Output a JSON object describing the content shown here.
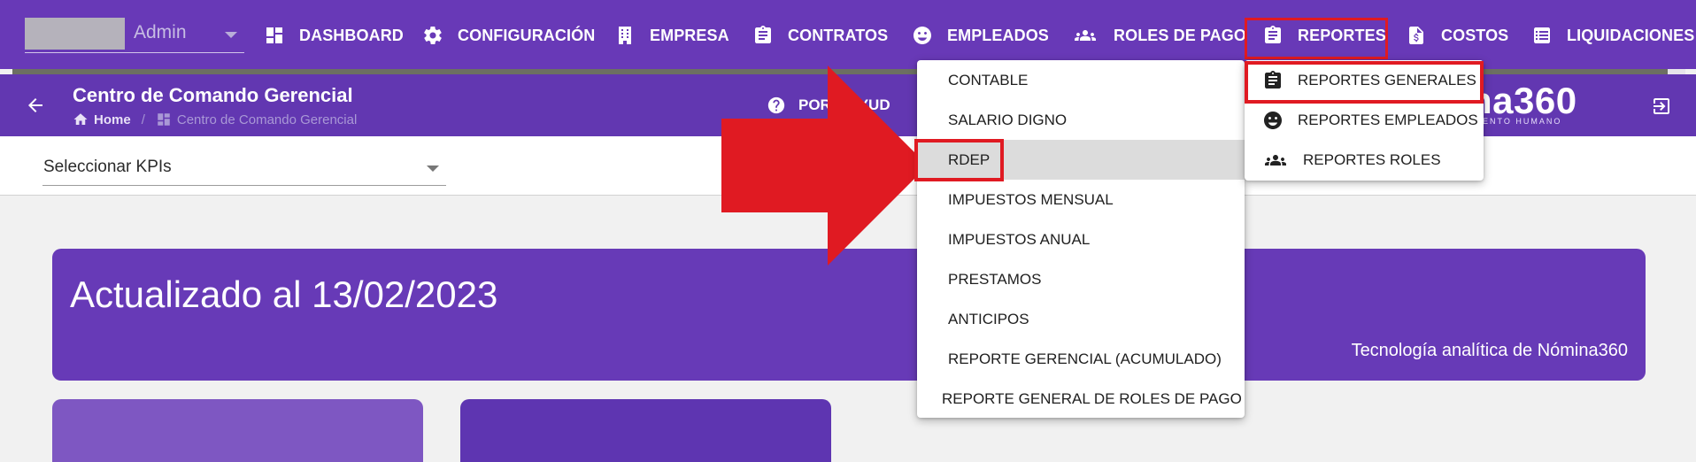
{
  "topnav": {
    "user_name": "Admin",
    "items": [
      {
        "label": "DASHBOARD",
        "icon": "dashboard-icon"
      },
      {
        "label": "CONFIGURACIÓN",
        "icon": "gear-icon"
      },
      {
        "label": "EMPRESA",
        "icon": "building-icon"
      },
      {
        "label": "CONTRATOS",
        "icon": "clipboard-icon"
      },
      {
        "label": "EMPLEADOS",
        "icon": "face-icon"
      },
      {
        "label": "ROLES DE PAGO",
        "icon": "people-icon"
      },
      {
        "label": "REPORTES",
        "icon": "clipboard-icon"
      },
      {
        "label": "COSTOS",
        "icon": "dollar-doc-icon"
      },
      {
        "label": "LIQUIDACIONES",
        "icon": "list-icon"
      }
    ],
    "highlighted_item": "REPORTES"
  },
  "subheader": {
    "title": "Centro de Comando Gerencial",
    "breadcrumb_home": "Home",
    "breadcrumb_sep": "/",
    "breadcrumb_current": "Centro de Comando Gerencial",
    "help_text": "POR  E AYUD",
    "logo_text": "na360",
    "logo_sub": "ALENTO HUMANO"
  },
  "kpi": {
    "select_label": "Seleccionar KPIs"
  },
  "banner": {
    "title": "Actualizado al 13/02/2023",
    "subtitle": "Tecnología analítica de Nómina360"
  },
  "menu_contable": {
    "items": [
      "CONTABLE",
      "SALARIO DIGNO",
      "RDEP",
      "IMPUESTOS MENSUAL",
      "IMPUESTOS ANUAL",
      "PRESTAMOS",
      "ANTICIPOS",
      "REPORTE GERENCIAL (ACUMULADO)",
      "REPORTE GENERAL DE ROLES DE PAGO"
    ],
    "highlighted": "RDEP"
  },
  "menu_reportes": {
    "items": [
      {
        "label": "REPORTES GENERALES",
        "icon": "clipboard-icon"
      },
      {
        "label": "REPORTES EMPLEADOS",
        "icon": "face-icon"
      },
      {
        "label": "REPORTES ROLES",
        "icon": "people-icon"
      }
    ],
    "highlighted": "REPORTES GENERALES"
  },
  "colors": {
    "nav_purple": "#6839b7",
    "banner_purple": "#673ab7",
    "highlight_red": "#e01a22"
  }
}
